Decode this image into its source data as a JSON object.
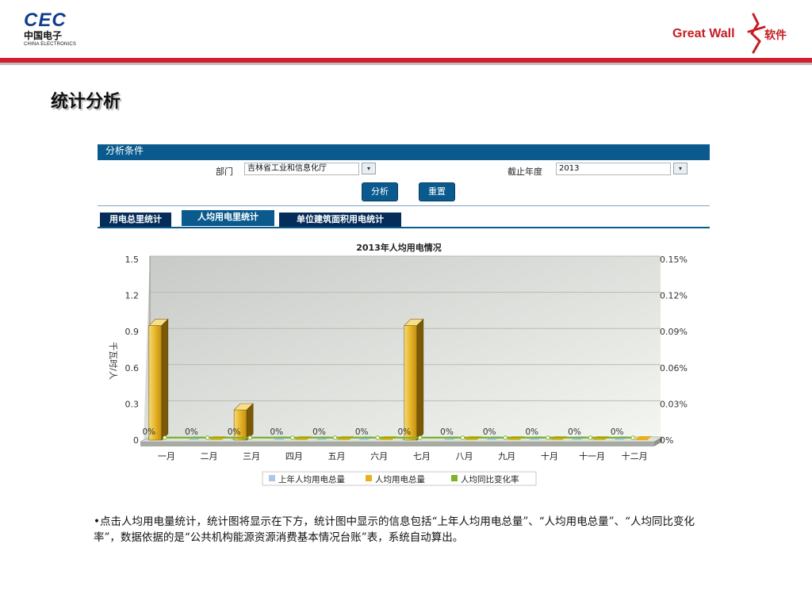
{
  "header": {
    "cec_logo": {
      "main": "CEC",
      "zh": "中国电子",
      "en": "CHINA ELECTRONICS"
    },
    "gw_logo": {
      "text": "Great Wall",
      "soft": "软件"
    },
    "accent_red": "#d21f2b"
  },
  "slide_title": "统计分析",
  "panel": {
    "header": "分析条件",
    "department_label": "部门",
    "department_value": "吉林省工业和信息化厅",
    "year_label": "截止年度",
    "year_value": "2013",
    "analyze_button": "分析",
    "reset_button": "重置",
    "accent": "#0b5a8e"
  },
  "tabs": [
    {
      "label": "用电总里统计",
      "active": false
    },
    {
      "label": "人均用电里统计",
      "active": true
    },
    {
      "label": "单位建筑面积用电统计",
      "active": false
    }
  ],
  "chart_data": {
    "type": "bar",
    "title": "2013年人均用电情况",
    "ylabel": "千瓦时/人",
    "ylim": [
      0,
      1.5
    ],
    "y_ticks": [
      "1.5",
      "1.2",
      "0.9",
      "0.6",
      "0.3",
      "0"
    ],
    "y2_ticks": [
      "0.15%",
      "0.12%",
      "0.09%",
      "0.06%",
      "0.03%",
      "0%"
    ],
    "y2lim": [
      0,
      0.15
    ],
    "grid": true,
    "legend_position": "bottom",
    "categories": [
      "一月",
      "二月",
      "三月",
      "四月",
      "五月",
      "六月",
      "七月",
      "八月",
      "九月",
      "十月",
      "十一月",
      "十二月"
    ],
    "series": [
      {
        "name": "上年人均用电总量",
        "color": "#a9c9e8",
        "values": [
          0,
          0,
          0,
          0,
          0,
          0,
          0,
          0,
          0,
          0,
          0,
          0
        ]
      },
      {
        "name": "人均用电总量",
        "color": "#e8b11c",
        "values": [
          0.95,
          0,
          0.25,
          0,
          0,
          0,
          0.95,
          0,
          0,
          0,
          0,
          0
        ]
      },
      {
        "name": "人均同比变化率",
        "color": "#7ab526",
        "values": [
          0,
          0,
          0,
          0,
          0,
          0,
          0,
          0,
          0,
          0,
          0,
          0
        ]
      }
    ],
    "data_labels": [
      "0%",
      "0%",
      "0%",
      "0%",
      "0%",
      "0%",
      "0%",
      "0%",
      "0%",
      "0%",
      "0%",
      "0%"
    ]
  },
  "note": "•点击人均用电量统计，统计图将显示在下方，统计图中显示的信息包括“上年人均用电总量”、“人均用电总量”、“人均同比变化率”，数据依据的是“公共机构能源资源消费基本情况台账”表，系统自动算出。"
}
